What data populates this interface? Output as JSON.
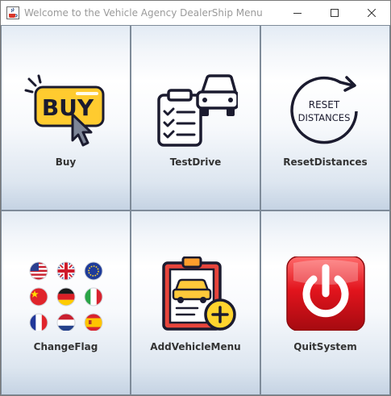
{
  "window": {
    "title": "Welcome to the Vehicle Agency DealerShip Menu",
    "app_icon": "java-cup-icon",
    "controls": [
      "minimize-icon",
      "maximize-icon",
      "close-icon"
    ]
  },
  "menu": {
    "buttons": [
      {
        "label": "Buy",
        "icon": "buy-icon",
        "icon_text": "BUY"
      },
      {
        "label": "TestDrive",
        "icon": "test-drive-icon"
      },
      {
        "label": "ResetDistances",
        "icon": "reset-distances-icon",
        "icon_text": [
          "RESET",
          "DISTANCES"
        ]
      },
      {
        "label": "ChangeFlag",
        "icon": "flags-icon"
      },
      {
        "label": "AddVehicleMenu",
        "icon": "add-vehicle-icon"
      },
      {
        "label": "QuitSystem",
        "icon": "power-icon"
      }
    ]
  },
  "colors": {
    "buy_yellow": "#ffcb2f",
    "outline": "#1b1b2f",
    "clipboard_red": "#e8453c",
    "car_yellow": "#ffc93a",
    "quit_red": "#e2141d",
    "tile_gradient_bottom": "#c5d3e3"
  }
}
